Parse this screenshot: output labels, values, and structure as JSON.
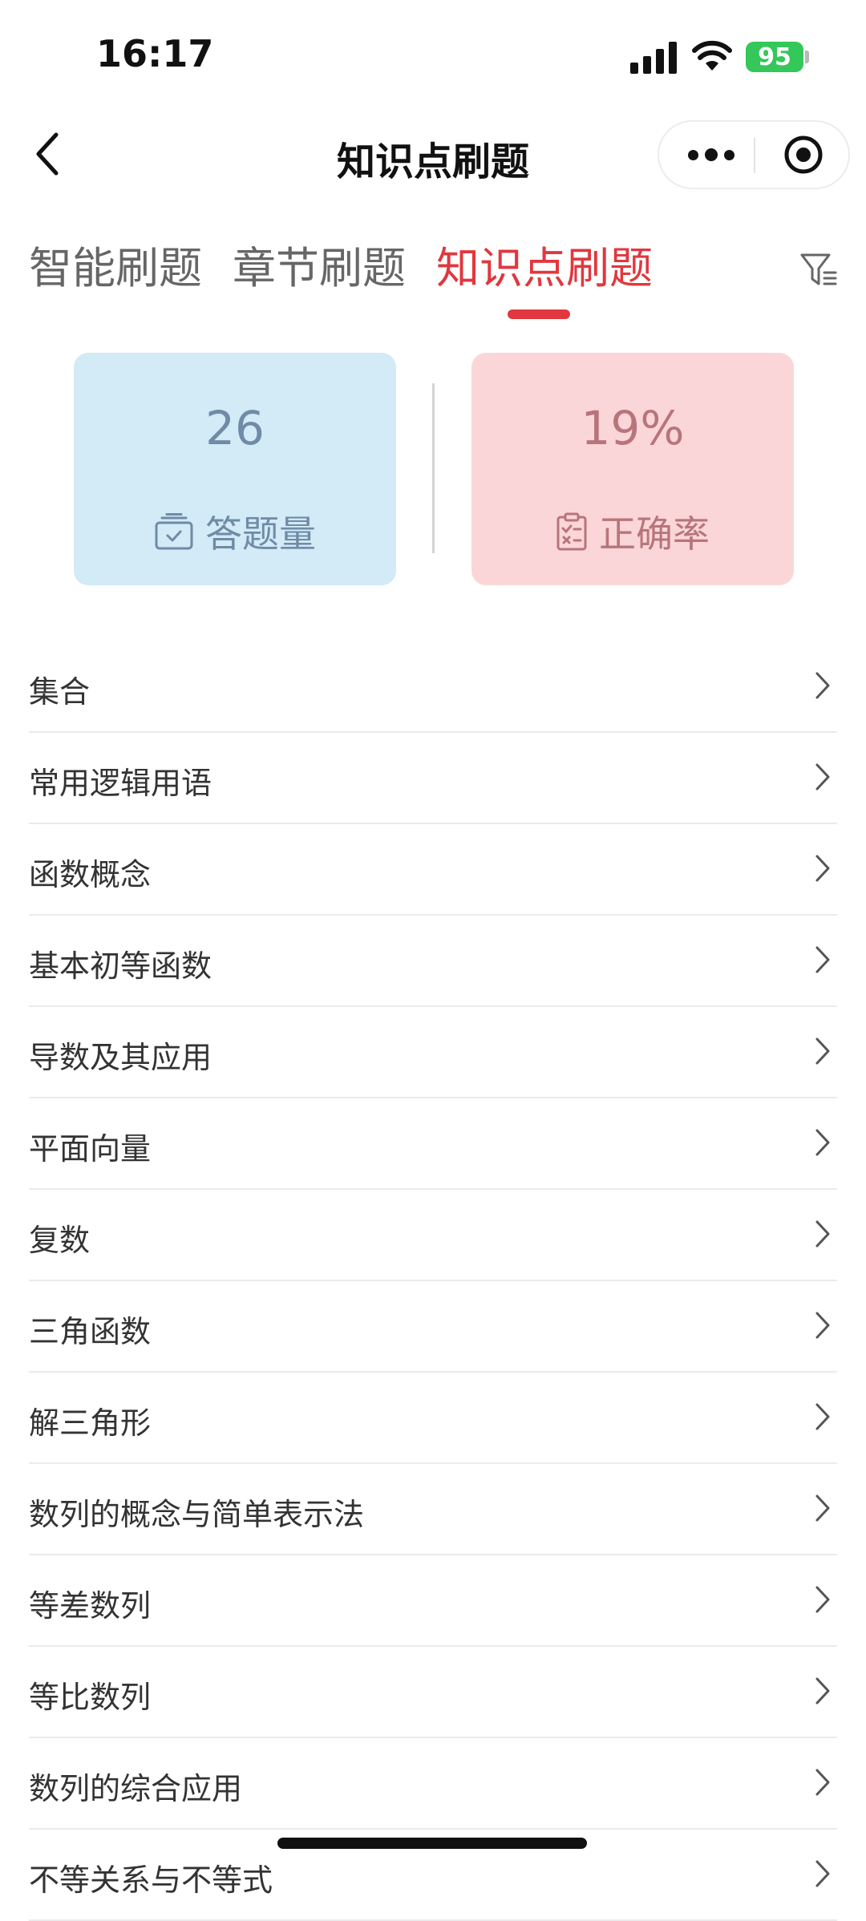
{
  "status_bar": {
    "time": "16:17",
    "battery": "95"
  },
  "nav": {
    "title": "知识点刷题"
  },
  "tabs": [
    {
      "label": "智能刷题",
      "active": false
    },
    {
      "label": "章节刷题",
      "active": false
    },
    {
      "label": "知识点刷题",
      "active": true
    }
  ],
  "stats": {
    "answered": {
      "value": "26",
      "label": "答题量"
    },
    "accuracy": {
      "value": "19%",
      "label": "正确率"
    }
  },
  "topics": [
    "集合",
    "常用逻辑用语",
    "函数概念",
    "基本初等函数",
    "导数及其应用",
    "平面向量",
    "复数",
    "三角函数",
    "解三角形",
    "数列的概念与简单表示法",
    "等差数列",
    "等比数列",
    "数列的综合应用",
    "不等关系与不等式"
  ],
  "colors": {
    "accent": "#e0383e",
    "card_blue": "#d3eaf7",
    "card_red": "#fbd6d8"
  },
  "icons": [
    "back-icon",
    "more-icon",
    "target-icon",
    "filter-icon",
    "tray-check-icon",
    "clipboard-icon",
    "chevron-right-icon"
  ]
}
